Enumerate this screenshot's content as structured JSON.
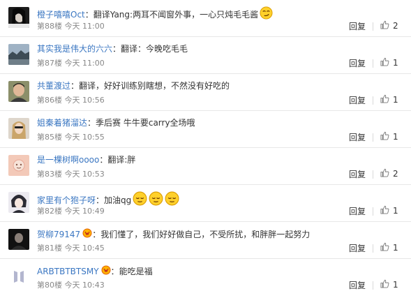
{
  "comments": [
    {
      "username": "橙子嘻嘻Oct",
      "separator": "：",
      "text": "翻译Yang:两耳不闻窗外事，一心只炖毛毛酱",
      "emoji": [
        "smirk-emoji"
      ],
      "floor": "第88楼",
      "time": "今天 11:00",
      "reply": "回复",
      "likes": "2",
      "avatar_icon": "avatar-dark-portrait"
    },
    {
      "username": "其实我是伟大的六六",
      "separator": "：",
      "text": "翻译：今晚吃毛毛",
      "emoji": [],
      "floor": "第87楼",
      "time": "今天 11:00",
      "reply": "回复",
      "likes": "1",
      "avatar_icon": "avatar-landscape"
    },
    {
      "username": "共董渡过",
      "separator": "：",
      "text": "翻译，好好训练别瞎想，不然没有好吃的",
      "emoji": [],
      "floor": "第86楼",
      "time": "今天 10:56",
      "reply": "回复",
      "likes": "1",
      "avatar_icon": "avatar-man-portrait"
    },
    {
      "username": "姐秦着猪溜达",
      "separator": "：",
      "text": "季后赛 牛牛要carry全场哦",
      "emoji": [],
      "floor": "第85楼",
      "time": "今天 10:55",
      "reply": "回复",
      "likes": "1",
      "avatar_icon": "avatar-blonde-portrait"
    },
    {
      "username": "是一棵树啊oooo",
      "separator": "：",
      "text": "翻译:胖",
      "emoji": [],
      "floor": "第83楼",
      "time": "今天 10:53",
      "reply": "回复",
      "likes": "2",
      "avatar_icon": "avatar-pink-cartoon"
    },
    {
      "username": "家里有个狍子呀",
      "separator": "：",
      "text": "加油qg",
      "emoji": [
        "relieved-emoji",
        "relieved-emoji",
        "relieved-emoji"
      ],
      "floor": "第82楼",
      "time": "今天 10:49",
      "reply": "回复",
      "likes": "1",
      "avatar_icon": "avatar-anime-portrait"
    },
    {
      "username": "贺柳79147",
      "separator": "：",
      "text": "我们懂了，我们好好做自己，不受所扰，和胖胖一起努力",
      "emoji": [],
      "badge": "vip-badge-icon",
      "floor": "第81楼",
      "time": "今天 10:45",
      "reply": "回复",
      "likes": "1",
      "avatar_icon": "avatar-dark-portrait-2"
    },
    {
      "username": "ARBTBTBTSMY",
      "separator": "：",
      "text": "能吃是福",
      "emoji": [],
      "badge": "vip-badge-icon",
      "floor": "第80楼",
      "time": "今天 10:43",
      "reply": "回复",
      "likes": "1",
      "avatar_icon": "avatar-bts-logo"
    }
  ],
  "like_icon": "thumbs-up-icon",
  "colors": {
    "username": "#3b77c2",
    "text": "#333333",
    "meta": "#888888",
    "divider": "#e7e7e7"
  }
}
